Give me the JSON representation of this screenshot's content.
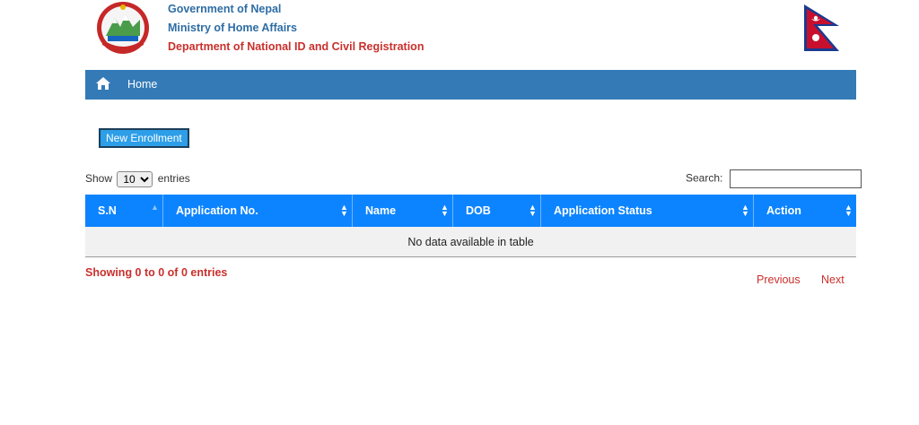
{
  "header": {
    "line1": "Government of Nepal",
    "line2": "Ministry of Home Affairs",
    "line3": "Department of National ID and Civil Registration",
    "emblem_icon": "nepal-emblem-icon",
    "flag_icon": "nepal-flag-icon"
  },
  "nav": {
    "home_icon": "home-icon",
    "home_label": "Home"
  },
  "actions": {
    "new_enrollment": "New Enrollment"
  },
  "table_controls": {
    "show_label": "Show",
    "length_value": "10",
    "entries_label": "entries",
    "search_label": "Search:",
    "search_value": ""
  },
  "table": {
    "columns": [
      "S.N",
      "Application No.",
      "Name",
      "DOB",
      "Application Status",
      "Action"
    ],
    "empty_message": "No data available in table"
  },
  "footer": {
    "info": "Showing 0 to 0 of 0 entries",
    "previous": "Previous",
    "next": "Next"
  },
  "colors": {
    "navbar": "#337ab7",
    "table_header": "#0d84ff",
    "accent_red": "#c9302c",
    "button": "#2d9ee8"
  }
}
